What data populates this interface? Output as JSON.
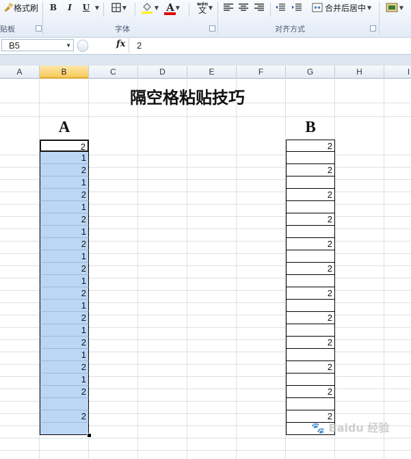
{
  "ribbon": {
    "format_painter": "格式刷",
    "clipboard_label": "贴板",
    "font_group_label": "字体",
    "align_group_label": "对齐方式",
    "merge_center": "合并后居中",
    "bold": "B",
    "italic": "I",
    "underline": "U",
    "font_color_glyph": "A",
    "phonetic_top": "wén",
    "phonetic_char": "文"
  },
  "formula_bar": {
    "name_box": "B5",
    "fx": "fx",
    "value": "2"
  },
  "columns": [
    "A",
    "B",
    "C",
    "D",
    "E",
    "F",
    "G",
    "H",
    "I"
  ],
  "selected_column": "B",
  "sheet": {
    "title": "隔空格粘贴技巧",
    "header_a": "A",
    "header_b": "B",
    "col_a_values": [
      "2",
      "1",
      "2",
      "1",
      "2",
      "1",
      "2",
      "1",
      "2",
      "1",
      "2",
      "1",
      "2",
      "1",
      "2",
      "1",
      "2",
      "1",
      "2",
      "1",
      "2",
      "",
      "2",
      ""
    ],
    "col_b_values": [
      "2",
      "",
      "2",
      "",
      "2",
      "",
      "2",
      "",
      "2",
      "",
      "2",
      "",
      "2",
      "",
      "2",
      "",
      "2",
      "",
      "2",
      "",
      "2",
      "",
      "2",
      ""
    ]
  },
  "watermark": "Baidu 经验",
  "colors": {
    "selection_fill": "#bcd7f5",
    "selected_header": "#f8c95c"
  }
}
